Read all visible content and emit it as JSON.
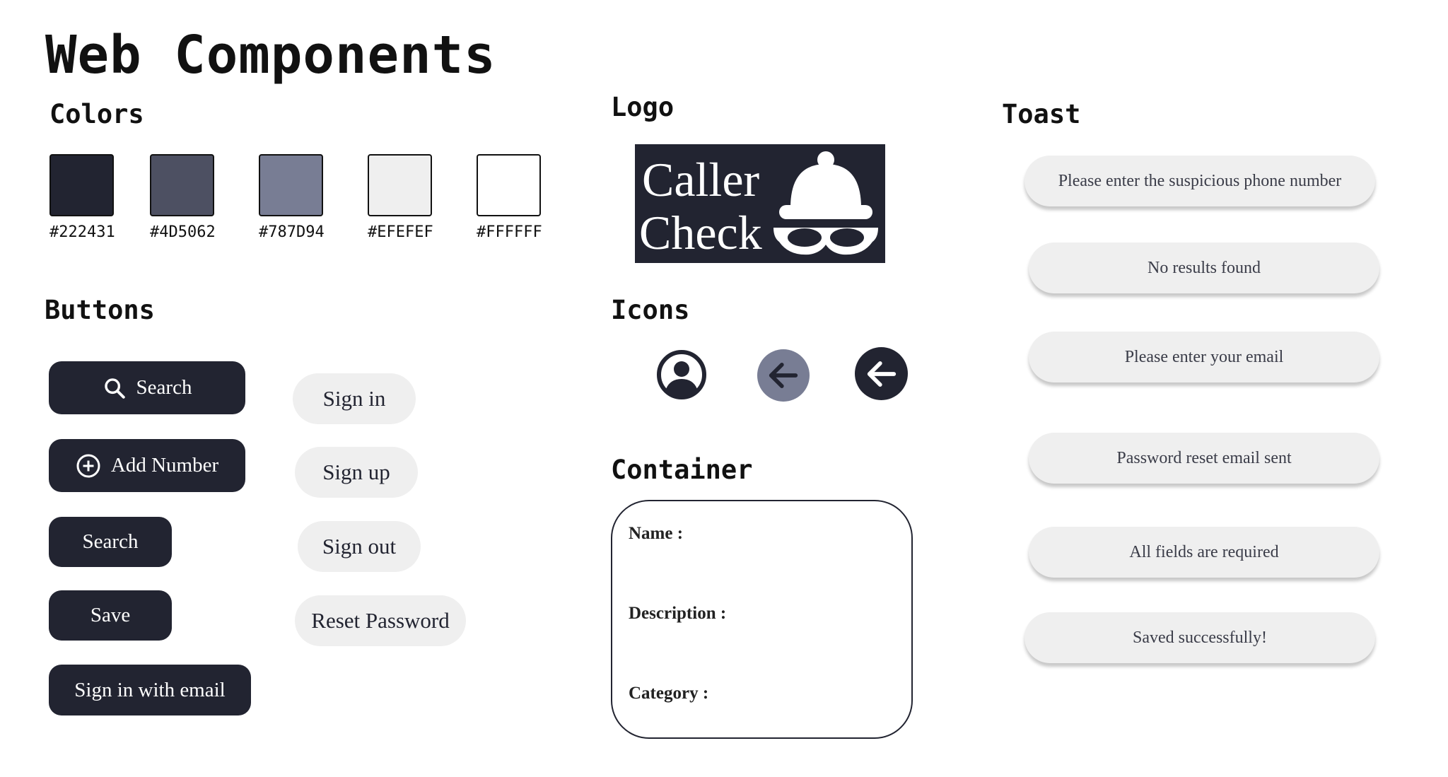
{
  "page": {
    "title": "Web Components"
  },
  "colors": {
    "title": "Colors",
    "swatches": [
      {
        "hex": "#222431",
        "label": "#222431"
      },
      {
        "hex": "#4D5062",
        "label": "#4D5062"
      },
      {
        "hex": "#787D94",
        "label": "#787D94"
      },
      {
        "hex": "#EFEFEF",
        "label": "#EFEFEF"
      },
      {
        "hex": "#FFFFFF",
        "label": "#FFFFFF"
      }
    ]
  },
  "buttons": {
    "title": "Buttons",
    "dark": [
      {
        "label": "Search",
        "icon": "search-icon"
      },
      {
        "label": "Add Number",
        "icon": "plus-circle-icon"
      },
      {
        "label": "Search"
      },
      {
        "label": "Save"
      },
      {
        "label": "Sign in with email"
      }
    ],
    "light": [
      {
        "label": "Sign in"
      },
      {
        "label": "Sign up"
      },
      {
        "label": "Sign out"
      },
      {
        "label": "Reset Password"
      }
    ]
  },
  "logo": {
    "title": "Logo",
    "line1": "Caller",
    "line2": "Check",
    "icon": "detective-icon"
  },
  "icons": {
    "title": "Icons",
    "items": [
      {
        "name": "user-circle-icon",
        "bg": "#FFFFFF"
      },
      {
        "name": "arrow-left-icon",
        "bg": "#787D94"
      },
      {
        "name": "arrow-left-icon",
        "bg": "#222431"
      }
    ]
  },
  "container": {
    "title": "Container",
    "fields": [
      "Name :",
      "Description :",
      "Category :"
    ]
  },
  "toast": {
    "title": "Toast",
    "messages": [
      "Please enter the suspicious phone number",
      "No results found",
      "Please enter your email",
      "Password reset email sent",
      "All fields are required",
      "Saved successfully!"
    ]
  },
  "theme": {
    "primary": "#222431",
    "secondary": "#4D5062",
    "muted": "#787D94",
    "light": "#EFEFEF",
    "white": "#FFFFFF"
  }
}
